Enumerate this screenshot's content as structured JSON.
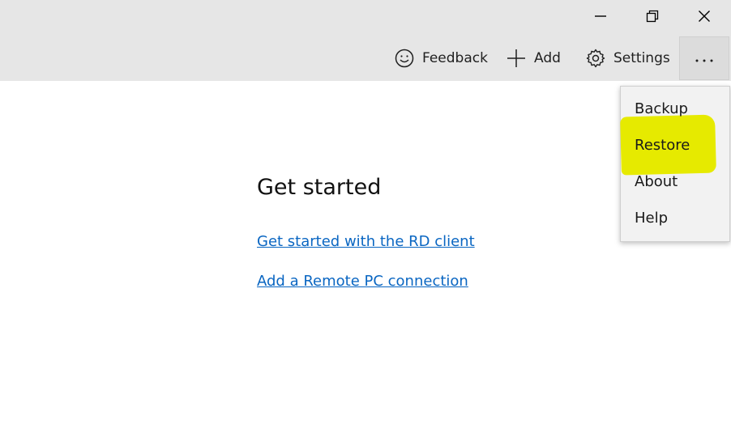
{
  "window_controls": {
    "minimize_icon": "minimize-icon",
    "restore_icon": "restore-icon",
    "close_icon": "close-icon"
  },
  "commands": {
    "feedback_label": "Feedback",
    "add_label": "Add",
    "settings_label": "Settings",
    "more_icon": "ellipsis-icon"
  },
  "main": {
    "title": "Get started",
    "link_rd_client": "Get started with the RD client",
    "link_add_remote_pc": "Add a Remote PC connection"
  },
  "menu": {
    "items": [
      {
        "label": "Backup"
      },
      {
        "label": "Restore"
      },
      {
        "label": "About"
      },
      {
        "label": "Help"
      }
    ],
    "highlight_color": "#e6ea00"
  },
  "colors": {
    "topbar_bg": "#e6e6e6",
    "link": "#0a66c2",
    "menu_bg": "#f2f2f2"
  }
}
